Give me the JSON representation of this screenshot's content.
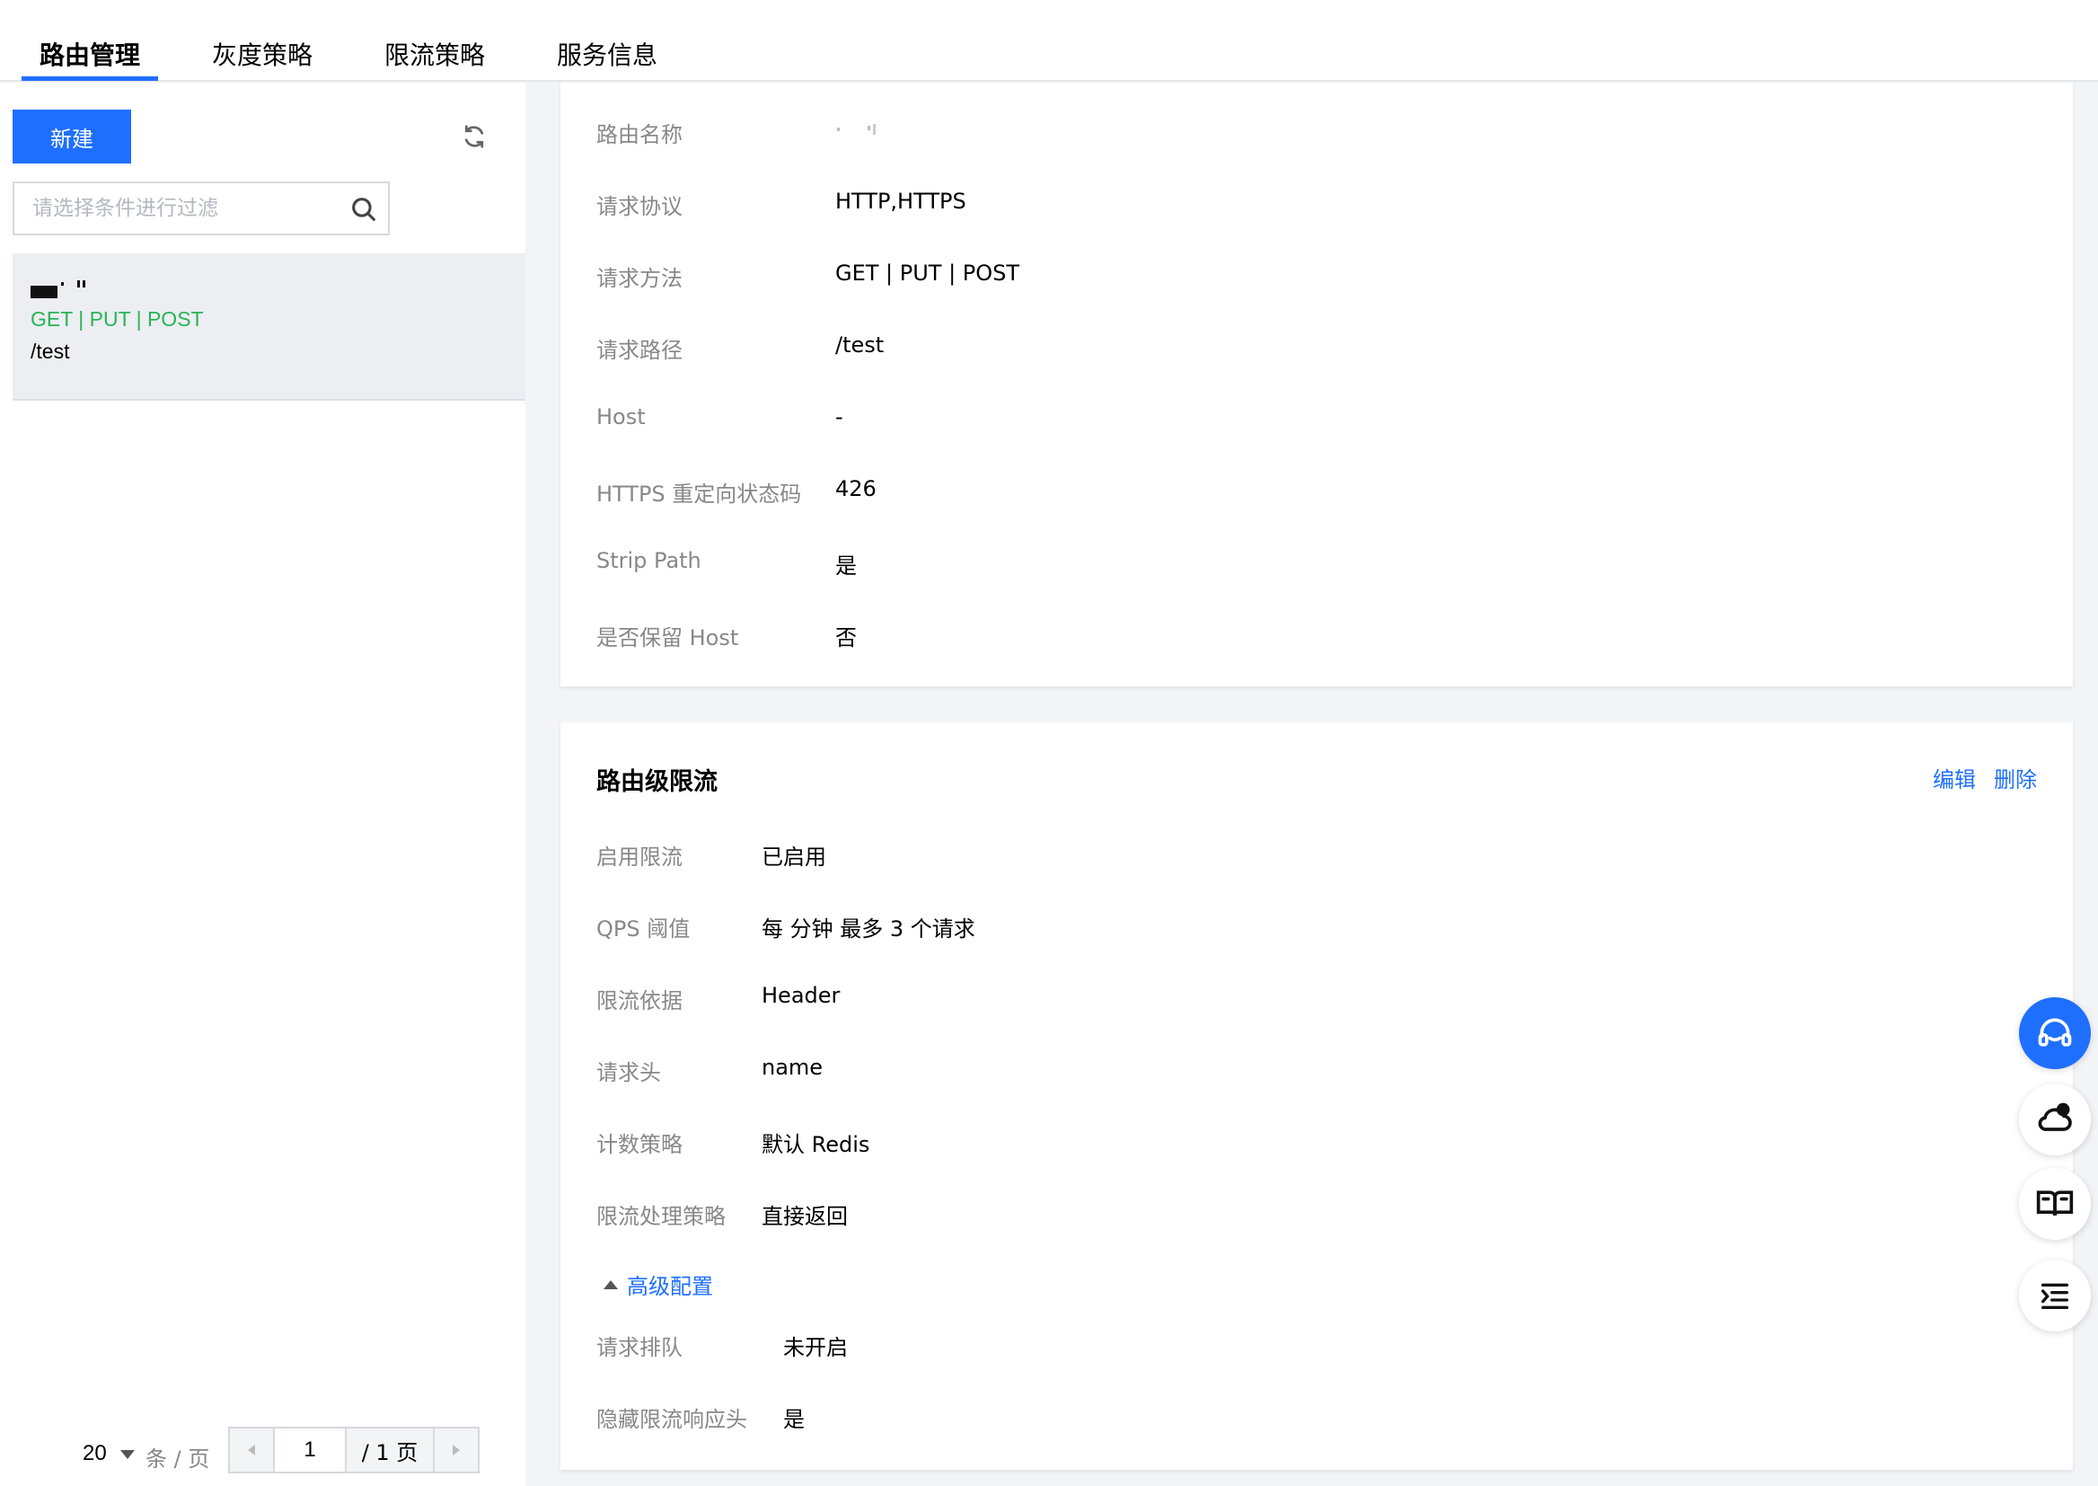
{
  "tabs": [
    {
      "label": "路由管理",
      "active": true
    },
    {
      "label": "灰度策略",
      "active": false
    },
    {
      "label": "限流策略",
      "active": false
    },
    {
      "label": "服务信息",
      "active": false
    }
  ],
  "left": {
    "new_button": "新建",
    "search_placeholder": "请选择条件进行过滤",
    "route": {
      "methods": "GET | PUT | POST",
      "path": "/test"
    },
    "pagination": {
      "page_size": "20",
      "page_size_unit": "条 / 页",
      "current_page": "1",
      "total": "/ 1 页"
    }
  },
  "basic": {
    "rows": [
      {
        "label": "路由名称",
        "value": ""
      },
      {
        "label": "请求协议",
        "value": "HTTP,HTTPS"
      },
      {
        "label": "请求方法",
        "value": "GET | PUT | POST"
      },
      {
        "label": "请求路径",
        "value": "/test"
      },
      {
        "label": "Host",
        "value": "-"
      },
      {
        "label": "HTTPS 重定向状态码",
        "value": "426"
      },
      {
        "label": "Strip Path",
        "value": "是"
      },
      {
        "label": "是否保留 Host",
        "value": "否"
      }
    ]
  },
  "limit": {
    "title": "路由级限流",
    "edit": "编辑",
    "delete": "删除",
    "rows": [
      {
        "label": "启用限流",
        "value": "已启用"
      },
      {
        "label": "QPS 阈值",
        "value": "每 分钟 最多 3 个请求"
      },
      {
        "label": "限流依据",
        "value": "Header"
      },
      {
        "label": "请求头",
        "value": "name"
      },
      {
        "label": "计数策略",
        "value": "默认 Redis"
      },
      {
        "label": "限流处理策略",
        "value": "直接返回"
      }
    ],
    "advanced_label": "高级配置",
    "advanced_rows": [
      {
        "label": "请求排队",
        "value": "未开启"
      },
      {
        "label": "隐藏限流响应头",
        "value": "是"
      }
    ]
  },
  "colors": {
    "accent": "#1f6fff",
    "method_green": "#29b356",
    "label_gray": "#888888"
  },
  "floating_icons": [
    "headset-icon",
    "cloud-alert-icon",
    "book-icon",
    "list-indent-icon"
  ]
}
